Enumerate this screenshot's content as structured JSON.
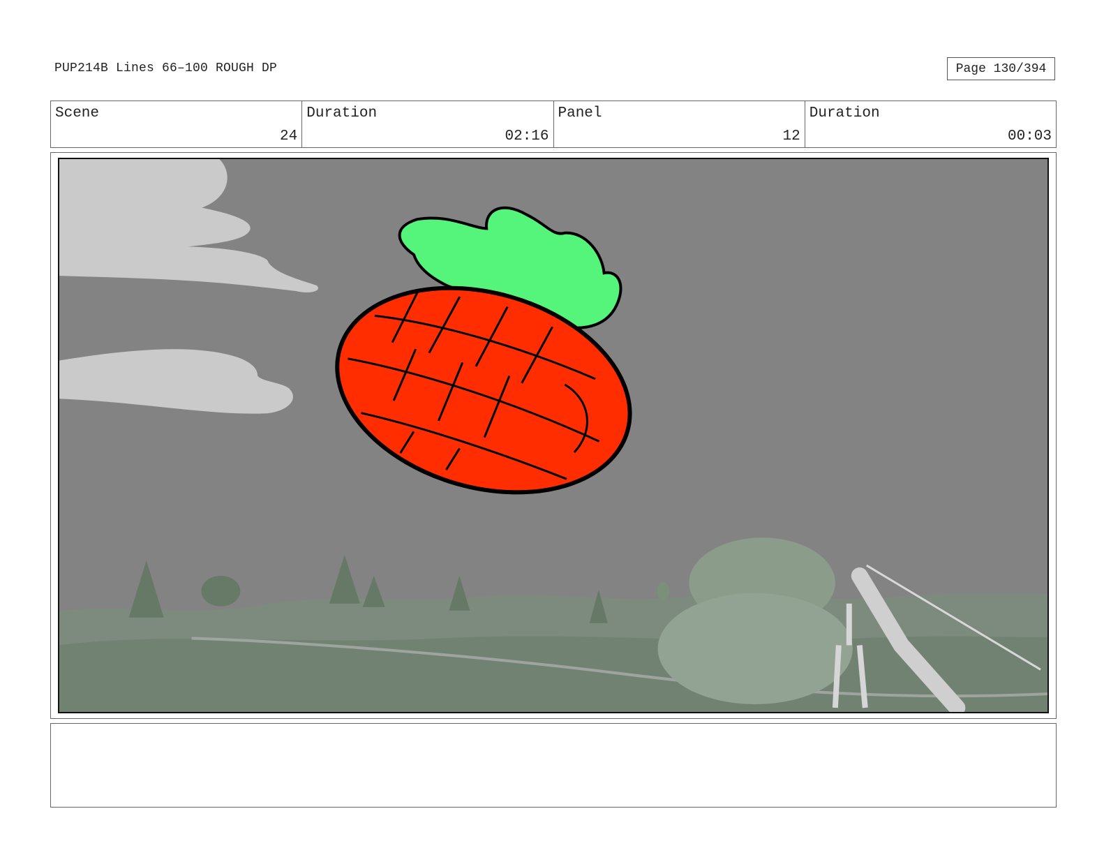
{
  "header": {
    "title": "PUP214B Lines 66–100 ROUGH DP",
    "page_label": "Page 130/394"
  },
  "info": {
    "scene_label": "Scene",
    "scene_value": "24",
    "scene_duration_label": "Duration",
    "scene_duration_value": "02:16",
    "panel_label": "Panel",
    "panel_value": "12",
    "panel_duration_label": "Duration",
    "panel_duration_value": "00:03"
  },
  "panel": {
    "sky_color": "#838383",
    "fruit_color": "#ff2d00",
    "leaf_color": "#55f47a",
    "hill_color": "#7a8a7a"
  },
  "notes": {
    "text": ""
  }
}
